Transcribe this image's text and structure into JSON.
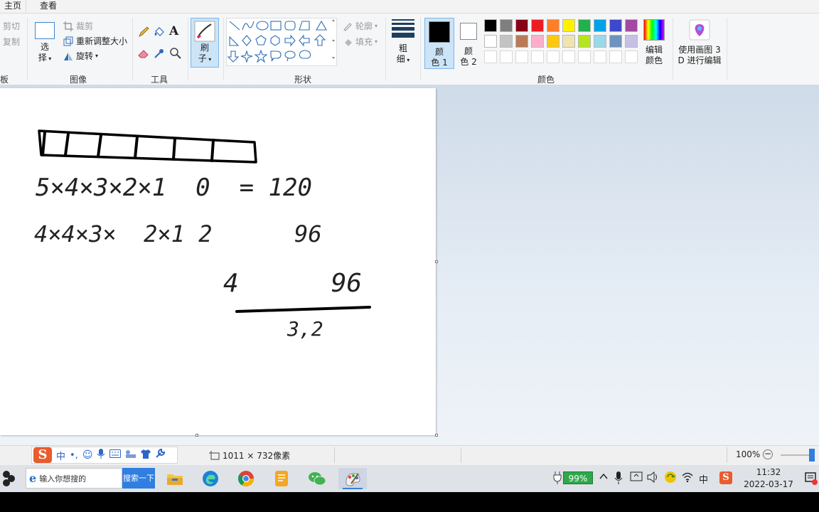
{
  "tabs": {
    "home": "主页",
    "view": "查看"
  },
  "clipboard": {
    "cut": "剪切",
    "copy": "复制",
    "group_fragment": "板"
  },
  "image_group": {
    "select_line1": "选",
    "select_line2": "择",
    "crop": "裁剪",
    "resize": "重新调整大小",
    "rotate": "旋转",
    "label": "图像"
  },
  "tools_group": {
    "label": "工具"
  },
  "brush": {
    "line1": "刷",
    "line2": "子"
  },
  "shapes_group": {
    "outline": "轮廓",
    "fill": "填充",
    "label": "形状"
  },
  "size_btn": {
    "line1": "粗",
    "line2": "细"
  },
  "color1": {
    "line1": "颜",
    "line2": "色 1",
    "value": "#000000"
  },
  "color2": {
    "line1": "颜",
    "line2": "色 2",
    "value": "#ffffff"
  },
  "colors_group": {
    "label": "颜色",
    "row1": [
      "#000000",
      "#7f7f7f",
      "#880015",
      "#ed1c24",
      "#ff7f27",
      "#fff200",
      "#22b14c",
      "#00a2e8",
      "#3f48cc",
      "#a349a4"
    ],
    "row2": [
      "#ffffff",
      "#c3c3c3",
      "#b97a57",
      "#ffaec9",
      "#ffc90e",
      "#efe4b0",
      "#b5e61d",
      "#99d9ea",
      "#7092be",
      "#c8bfe7"
    ]
  },
  "edit_colors": {
    "line1": "编辑",
    "line2": "颜色"
  },
  "paint3d": {
    "line1": "使用画图 3",
    "line2": "D 进行编辑"
  },
  "statusbar": {
    "dimensions": "1011 × 732像素",
    "zoom": "100%",
    "ime_chars": {
      "zh": "中",
      "punct": "•,"
    }
  },
  "taskbar": {
    "search_placeholder": "输入你想搜的",
    "search_button": "搜索一下",
    "battery": "99%",
    "ime_indicator": "中",
    "time": "11:32",
    "date": "2022-03-17"
  },
  "drawing": {
    "line1": "5×4×3×2×1  0  = 120",
    "line2": "4×4×3×  2×1 2      96",
    "line3": "4      96",
    "line4": "3,2"
  }
}
